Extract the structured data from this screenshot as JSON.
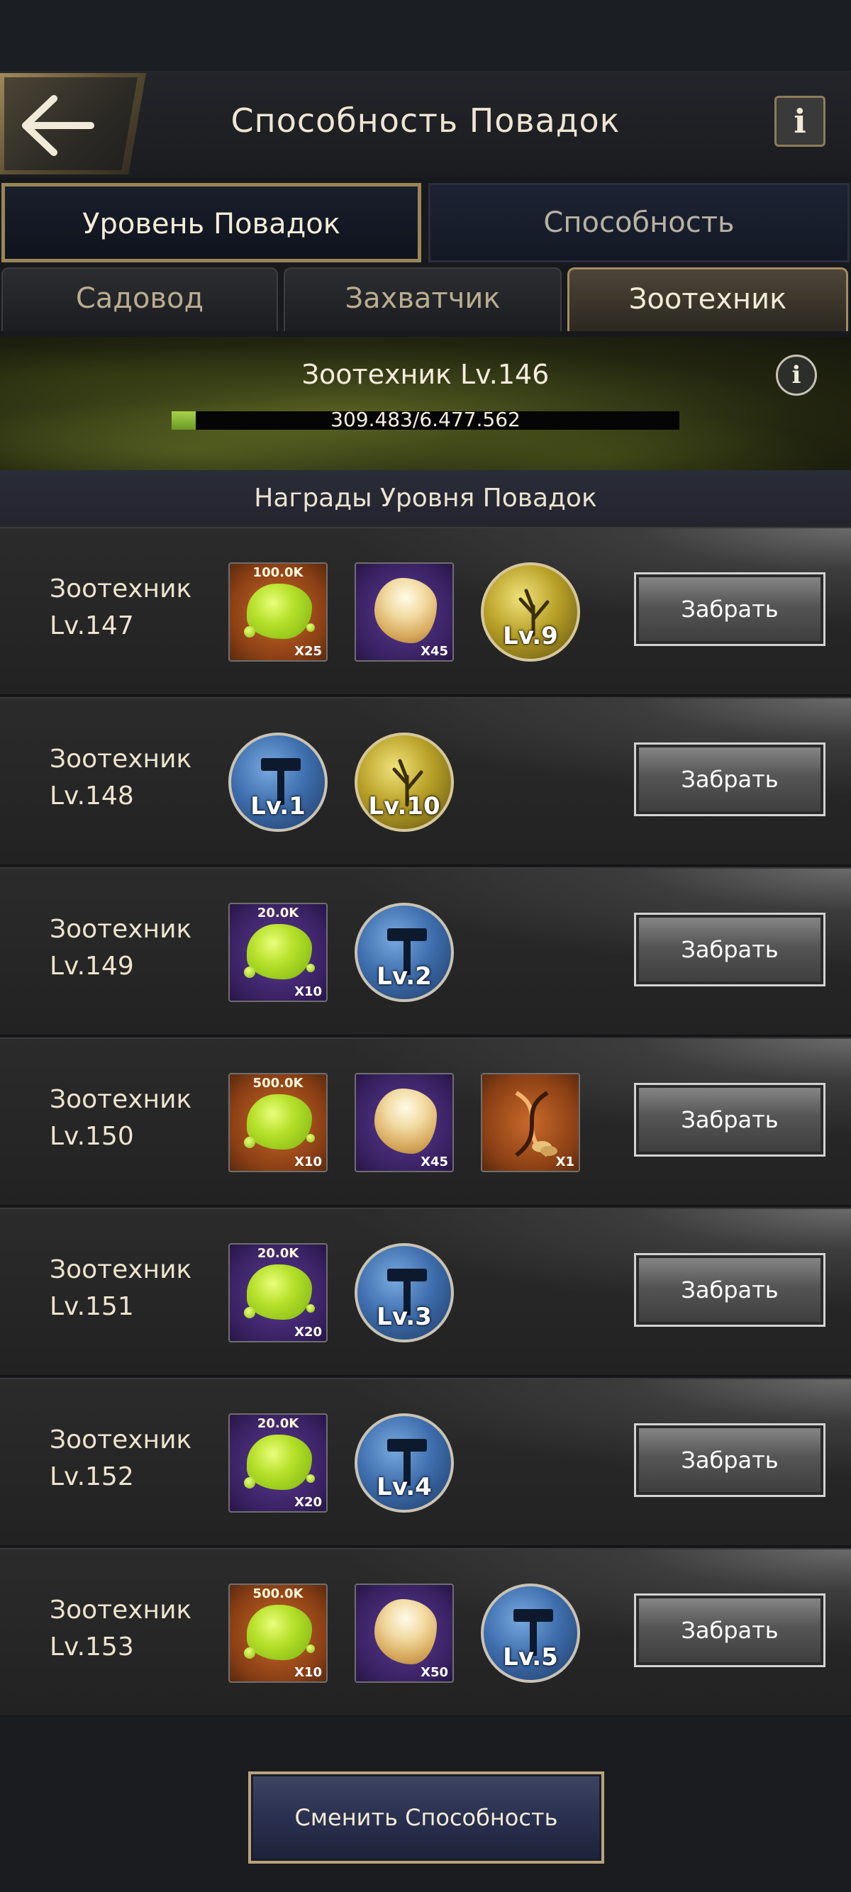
{
  "header": {
    "title": "Способность Повадок",
    "info_label": "i"
  },
  "tabs_main": [
    {
      "label": "Уровень Повадок",
      "active": true
    },
    {
      "label": "Способность",
      "active": false
    }
  ],
  "tabs_sub": [
    {
      "label": "Садовод",
      "active": false
    },
    {
      "label": "Захватчик",
      "active": false
    },
    {
      "label": "Зоотехник",
      "active": true
    }
  ],
  "banner": {
    "title": "Зоотехник Lv.146",
    "progress_text": "309.483/6.477.562",
    "progress_fraction": 0.048,
    "info_label": "i"
  },
  "rewards_header": "Награды Уровня Повадок",
  "rows": [
    {
      "name": "Зоотехник",
      "level": "Lv.147",
      "items": [
        {
          "kind": "slime",
          "bg": "orange",
          "top": "100.0K",
          "qty": "X25"
        },
        {
          "kind": "shell",
          "bg": "purple",
          "qty": "X45"
        },
        {
          "kind": "circle-gold",
          "lv": "Lv.9"
        }
      ],
      "button": "Забрать"
    },
    {
      "name": "Зоотехник",
      "level": "Lv.148",
      "items": [
        {
          "kind": "circle-blue",
          "lv": "Lv.1"
        },
        {
          "kind": "circle-gold",
          "lv": "Lv.10"
        }
      ],
      "button": "Забрать"
    },
    {
      "name": "Зоотехник",
      "level": "Lv.149",
      "items": [
        {
          "kind": "slime",
          "bg": "purple",
          "top": "20.0K",
          "qty": "X10"
        },
        {
          "kind": "circle-blue",
          "lv": "Lv.2"
        }
      ],
      "button": "Забрать"
    },
    {
      "name": "Зоотехник",
      "level": "Lv.150",
      "items": [
        {
          "kind": "slime",
          "bg": "orange",
          "top": "500.0K",
          "qty": "X10"
        },
        {
          "kind": "shell",
          "bg": "purple",
          "qty": "X45"
        },
        {
          "kind": "dna",
          "bg": "orange",
          "qty": "X1"
        }
      ],
      "button": "Забрать"
    },
    {
      "name": "Зоотехник",
      "level": "Lv.151",
      "items": [
        {
          "kind": "slime",
          "bg": "purple",
          "top": "20.0K",
          "qty": "X20"
        },
        {
          "kind": "circle-blue",
          "lv": "Lv.3"
        }
      ],
      "button": "Забрать"
    },
    {
      "name": "Зоотехник",
      "level": "Lv.152",
      "items": [
        {
          "kind": "slime",
          "bg": "purple",
          "top": "20.0K",
          "qty": "X20"
        },
        {
          "kind": "circle-blue",
          "lv": "Lv.4"
        }
      ],
      "button": "Забрать"
    },
    {
      "name": "Зоотехник",
      "level": "Lv.153",
      "items": [
        {
          "kind": "slime",
          "bg": "orange",
          "top": "500.0K",
          "qty": "X10"
        },
        {
          "kind": "shell",
          "bg": "purple",
          "qty": "X50"
        },
        {
          "kind": "circle-blue",
          "lv": "Lv.5"
        }
      ],
      "button": "Забрать"
    }
  ],
  "footer": {
    "switch_label": "Сменить Способность"
  }
}
